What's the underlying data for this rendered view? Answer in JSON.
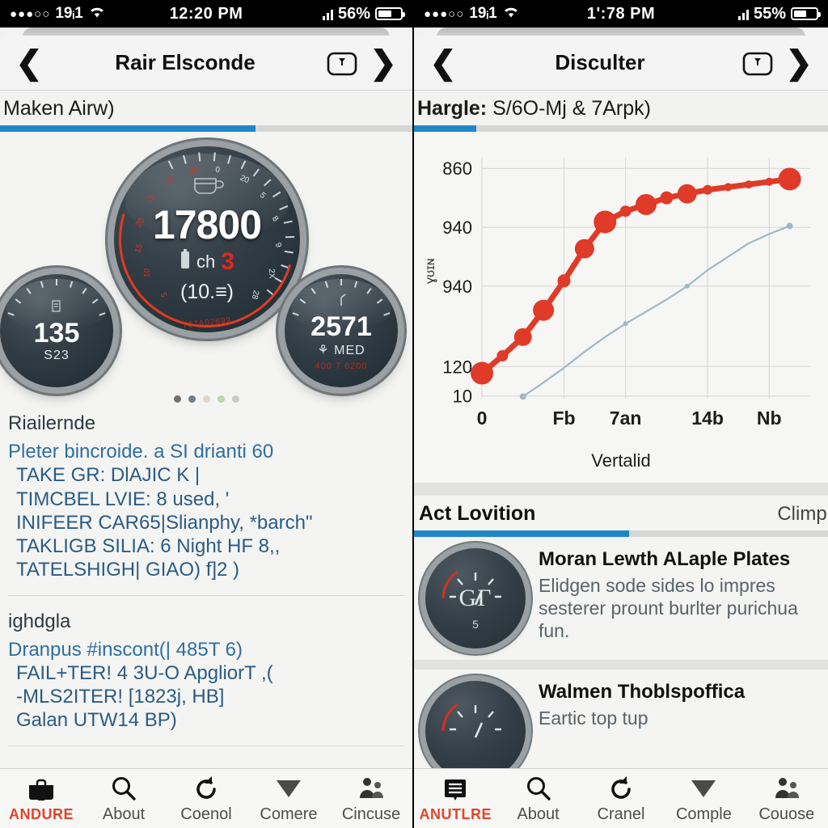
{
  "left": {
    "status_bar": {
      "signal_dots": "●●●○○",
      "carrier": "19ᵢ1",
      "wifi_icon": "wifi-icon",
      "time": "12:20 PM",
      "signal_icon": "cellular-bars-icon",
      "battery_pct": "56%",
      "battery_level": 56
    },
    "nav": {
      "back_icon": "chevron-left-icon",
      "title": "Rair Elsconde",
      "action_icon": "gauge-badge-icon",
      "forward_icon": "chevron-right-icon"
    },
    "subheader": {
      "text": "Maken Airw)"
    },
    "progress_pct": 62,
    "gauges": {
      "main": {
        "value": "17800",
        "sub_prefix": "ch",
        "gear": "3",
        "paren": "(10.≡)",
        "arc_label": "7$7A02899",
        "ticks_red": [
          "35",
          "30",
          "25",
          "20",
          "15",
          "10",
          "5"
        ],
        "ticks_white": [
          "0",
          "20",
          "5",
          "8",
          "9",
          "2X",
          "28"
        ]
      },
      "left": {
        "value": "135",
        "sub": "S23"
      },
      "right": {
        "value": "2571",
        "sub": "MED",
        "warn": "400 7 6200"
      }
    },
    "page_dots": [
      {
        "color": "#6f6f6f"
      },
      {
        "color": "#6b7f8e"
      },
      {
        "color": "#ded7c9"
      },
      {
        "color": "#b9d6ad"
      },
      {
        "color": "#c9c9c9"
      }
    ],
    "block1": {
      "heading": "Riailernde",
      "lines": [
        "Pleter bincroide. a SI drianti 60",
        "TAKE GR: DlAJIC K |",
        "TIMCBEL LVIE: 8 used, '",
        "INIFEER CAR65|Slianphy, *barch\"",
        "TAKLIGB SILIA: 6 Night HF 8,,",
        "TATELSHIGH| GIAO) f]2 )"
      ]
    },
    "block2": {
      "heading": "ighdgla",
      "lines": [
        "Dranpus #inscont(| 485T 6)",
        "FAIL+TER! 4 3U-O ApgliorT ,(",
        "-MLS2ITER! [1823j, HB]",
        "Galan  UTW14 BP)"
      ]
    },
    "tabs": [
      {
        "label": "ANDURE",
        "icon": "briefcase-icon",
        "active": true
      },
      {
        "label": "About",
        "icon": "search-icon",
        "active": false
      },
      {
        "label": "Coenol",
        "icon": "refresh-icon",
        "active": false
      },
      {
        "label": "Comere",
        "icon": "triangle-down-icon",
        "active": false
      },
      {
        "label": "Cincuse",
        "icon": "people-icon",
        "active": false
      }
    ]
  },
  "right": {
    "status_bar": {
      "signal_dots": "●●●○○",
      "carrier": "19ᵢ1",
      "wifi_icon": "wifi-icon",
      "time": "1':78 PM",
      "signal_icon": "cellular-bars-icon",
      "battery_pct": "55%",
      "battery_level": 55
    },
    "nav": {
      "back_icon": "chevron-left-icon",
      "title": "Disculter",
      "action_icon": "gauge-badge-icon",
      "forward_icon": "chevron-right-icon"
    },
    "subheader": {
      "label": "Hargle:",
      "value": "S/6O-Mj & 7Arpk)"
    },
    "progress_pct": 15,
    "section": {
      "title": "Act Lovition",
      "right_text": "Climpls"
    },
    "rows": [
      {
        "thumb_value": "GΓ",
        "thumb_sub": "5",
        "title": "Moran Lewth ALaple Plates",
        "desc": "Elidgen sode sides lo impres sesterer prount burlter purichua fun."
      },
      {
        "thumb_value": "",
        "thumb_sub": "",
        "title": "Walmen Thoblspoffica",
        "desc": "Eartic top tup"
      }
    ],
    "tabs": [
      {
        "label": "ANUTLRE",
        "icon": "list-icon",
        "active": true
      },
      {
        "label": "About",
        "icon": "search-icon",
        "active": false
      },
      {
        "label": "Cranel",
        "icon": "refresh-icon",
        "active": false
      },
      {
        "label": "Comple",
        "icon": "triangle-down-icon",
        "active": false
      },
      {
        "label": "Couose",
        "icon": "people-icon",
        "active": false
      }
    ]
  },
  "chart_data": {
    "type": "line",
    "title": "",
    "xlabel": "Vertalid",
    "ylabel": "ɣʊɪɴ",
    "xticks": [
      "0",
      "Fb",
      "7an",
      "14b",
      "Nb"
    ],
    "xtick_positions": [
      0,
      4,
      7,
      11,
      14
    ],
    "yticks": [
      "10",
      "120",
      "940",
      "940",
      "860"
    ],
    "ytick_values": [
      10,
      120,
      420,
      640,
      860
    ],
    "xlim": [
      0,
      16
    ],
    "ylim": [
      0,
      900
    ],
    "grid": true,
    "legend_position": "none",
    "series": [
      {
        "name": "primary",
        "color": "#e03a28",
        "x": [
          0,
          1,
          2,
          3,
          4,
          5,
          6,
          7,
          8,
          9,
          10,
          11,
          12,
          13,
          14,
          15
        ],
        "y": [
          95,
          160,
          230,
          330,
          440,
          560,
          660,
          700,
          725,
          750,
          765,
          780,
          790,
          800,
          810,
          820
        ],
        "marker_sizes": [
          14,
          7,
          11,
          13,
          8,
          12,
          14,
          7,
          13,
          8,
          12,
          6,
          5,
          5,
          5,
          14
        ]
      },
      {
        "name": "secondary",
        "color": "#9fb8c4",
        "x": [
          2,
          3,
          4,
          5,
          6,
          7,
          8,
          9,
          10,
          11,
          12,
          13,
          14,
          15
        ],
        "y": [
          8,
          60,
          115,
          175,
          230,
          280,
          325,
          370,
          420,
          480,
          530,
          580,
          615,
          645
        ],
        "marker_sizes": [
          4,
          0,
          0,
          0,
          0,
          3,
          0,
          0,
          3,
          0,
          0,
          0,
          0,
          4
        ]
      }
    ]
  }
}
